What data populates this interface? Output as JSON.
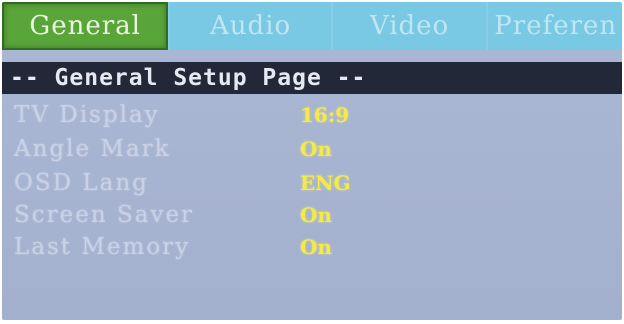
{
  "tabs": [
    {
      "label": "General",
      "active": true
    },
    {
      "label": "Audio",
      "active": false
    },
    {
      "label": "Video",
      "active": false
    },
    {
      "label": "Preferen",
      "active": false
    }
  ],
  "page_title": "-- General Setup Page --",
  "settings": [
    {
      "label": "TV Display",
      "value": "16:9"
    },
    {
      "label": "Angle Mark",
      "value": "On"
    },
    {
      "label": "OSD Lang",
      "value": "ENG"
    },
    {
      "label": "Screen Saver",
      "value": "On"
    },
    {
      "label": "Last Memory",
      "value": "On"
    }
  ],
  "colors": {
    "active_tab": "#5aa53a",
    "tab_bar": "#79c9e4",
    "title_bar": "#232838",
    "panel": "#a7b4d2",
    "value_text": "#f4ea4c",
    "label_text": "#c9d1e6"
  }
}
